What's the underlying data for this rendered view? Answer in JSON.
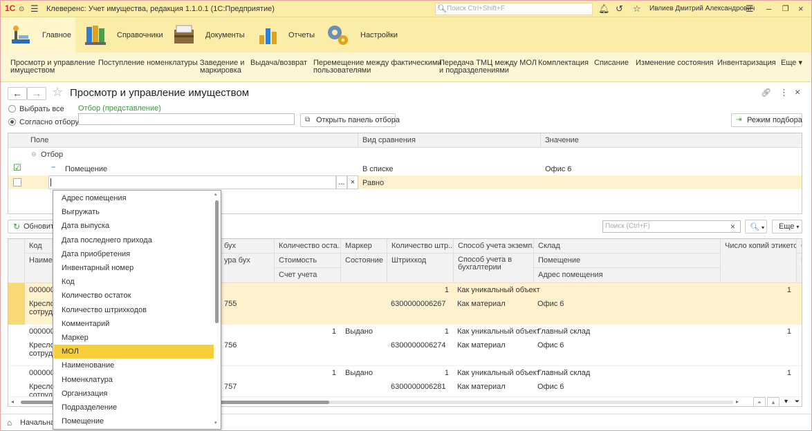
{
  "titlebar": {
    "logo": "1С",
    "app_title": "Клеверенс: Учет имущества, редакция 1.1.0.1  (1С:Предприятие)",
    "search_placeholder": "Поиск Ctrl+Shift+F",
    "user": "Ивлиев Дмитрий Александрович"
  },
  "sections": [
    {
      "label": "Главное"
    },
    {
      "label": "Справочники"
    },
    {
      "label": "Документы"
    },
    {
      "label": "Отчеты"
    },
    {
      "label": "Настройки"
    }
  ],
  "nav": {
    "items": [
      {
        "line1": "Просмотр и управление",
        "line2": "имуществом"
      },
      {
        "line1": "Поступление номенклатуры",
        "line2": ""
      },
      {
        "line1": "Заведение и",
        "line2": "маркировка"
      },
      {
        "line1": "Выдача/возврат",
        "line2": ""
      },
      {
        "line1": "Перемещение между фактическими",
        "line2": "пользователями"
      },
      {
        "line1": "Передача ТМЦ между МОЛ",
        "line2": "и подразделениями"
      },
      {
        "line1": "Комплектация",
        "line2": ""
      },
      {
        "line1": "Списание",
        "line2": ""
      },
      {
        "line1": "Изменение состояния",
        "line2": ""
      },
      {
        "line1": "Инвентаризация",
        "line2": ""
      },
      {
        "line1": "Еще",
        "line2": ""
      }
    ]
  },
  "form": {
    "title": "Просмотр и управление имуществом"
  },
  "filter": {
    "select_all": "Выбрать все",
    "by_filter": "Согласно отбору:",
    "filter_link": "Отбор (представление)",
    "filter_value": "",
    "open_panel": "Открыть панель отбора",
    "pick_mode": "Режим подбора"
  },
  "filter_grid": {
    "headers": {
      "field": "Поле",
      "comparison": "Вид сравнения",
      "value": "Значение"
    },
    "group": "Отбор",
    "row1": {
      "field": "Помещение",
      "comparison": "В списке",
      "value": "Офис 6"
    },
    "row2": {
      "field": "",
      "ellipsis": "...",
      "clear": "×",
      "comparison": "Равно",
      "value": ""
    }
  },
  "list_toolbar": {
    "refresh": "Обновить",
    "search_placeholder": "Поиск (Ctrl+F)",
    "more": "Еще"
  },
  "main_grid": {
    "headers": {
      "code": "Код",
      "name": "Наимен",
      "bux": "бух",
      "nom_bux": "ура бух",
      "qty": "Количество оста...",
      "cost": "Стоимость",
      "account": "Счет учета",
      "marker": "Маркер",
      "state": "Состояние",
      "barcodes": "Количество штр...",
      "barcode": "Штрихкод",
      "method": "Способ учета экземп...",
      "method_bux1": "Способ учета в",
      "method_bux2": "бухгалтерии",
      "warehouse": "Склад",
      "room": "Помещение",
      "room_address": "Адрес помещения",
      "labels": "Число копий этикеток",
      "extra": "С",
      "extra2": "П"
    },
    "rows": [
      {
        "code": "000000",
        "name1": "Кресло",
        "name2": "сотруд",
        "nom": "755",
        "qty": "",
        "marker": "",
        "bc_count": "1",
        "barcode": "6300000006267",
        "method": "Как уникальный объект",
        "method_bux": "Как материал",
        "warehouse": "",
        "room": "Офис 6",
        "labels": "1"
      },
      {
        "code": "000000",
        "name1": "Кресло",
        "name2": "сотруд",
        "nom": "756",
        "qty": "1",
        "marker": "Выдано",
        "bc_count": "1",
        "barcode": "6300000006274",
        "method": "Как уникальный объект",
        "method_bux": "Как материал",
        "warehouse": "Главный склад",
        "room": "Офис 6",
        "labels": "1"
      },
      {
        "code": "000000",
        "name1": "Кресло",
        "name2": "сотруд",
        "nom": "757",
        "qty": "1",
        "marker": "Выдано",
        "bc_count": "1",
        "barcode": "6300000006281",
        "method": "Как уникальный объект",
        "method_bux": "Как материал",
        "warehouse": "Главный склад",
        "room": "Офис 6",
        "labels": "1"
      }
    ]
  },
  "dropdown": {
    "items": [
      "Адрес помещения",
      "Выгружать",
      "Дата выпуска",
      "Дата последнего прихода",
      "Дата приобретения",
      "Инвентарный номер",
      "Код",
      "Количество остаток",
      "Количество штрихкодов",
      "Комментарий",
      "Маркер",
      "МОЛ",
      "Наименование",
      "Номенклатура",
      "Организация",
      "Подразделение",
      "Помещение"
    ],
    "selected_index": 11
  },
  "bottombar": {
    "home": "Начальна"
  }
}
